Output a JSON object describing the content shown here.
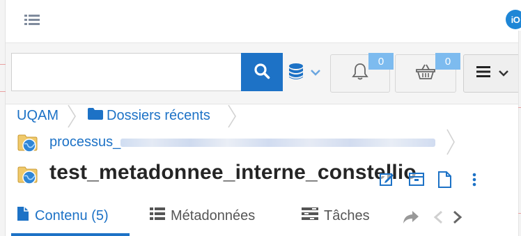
{
  "header": {
    "menu_icon": "list-icon",
    "brand_logo": "iO"
  },
  "search": {
    "placeholder": "",
    "value": "",
    "button_icon": "search-icon"
  },
  "toolbar": {
    "database_icon": "database-icon",
    "notifications": {
      "icon": "bell-icon",
      "count": "0"
    },
    "cart": {
      "icon": "basket-icon",
      "count": "0"
    },
    "menu_icon": "hamburger-icon"
  },
  "breadcrumb": [
    {
      "label": "UQAM"
    },
    {
      "label": "Dossiers récents",
      "icon": "folder-icon"
    }
  ],
  "document": {
    "parent_prefix": "processus_",
    "title": "test_metadonnee_interne_constellio"
  },
  "tabs": [
    {
      "label": "Contenu (5)",
      "icon": "file-icon",
      "active": true
    },
    {
      "label": "Métadonnées",
      "icon": "list-icon",
      "active": false
    },
    {
      "label": "Tâches",
      "icon": "tasks-icon",
      "active": false
    }
  ],
  "colors": {
    "accent": "#1d72c6",
    "badge": "#7dbbef",
    "brand": "#1e86d6"
  }
}
